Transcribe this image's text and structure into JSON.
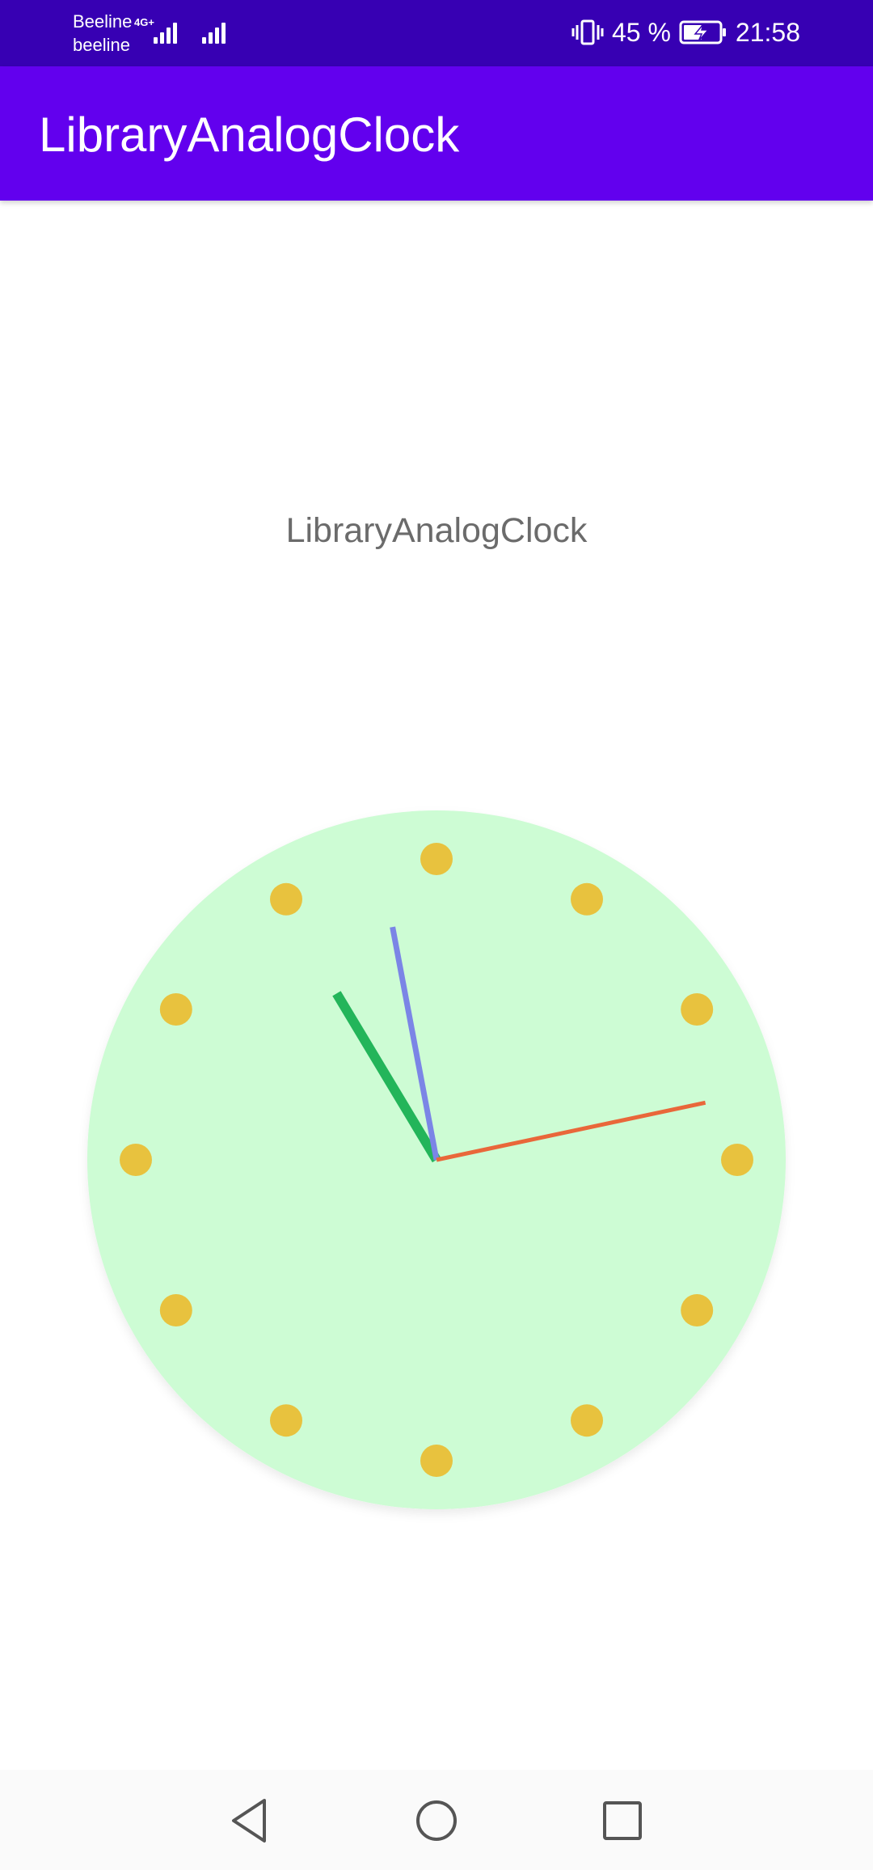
{
  "status_bar": {
    "carrier_1": "Beeline",
    "carrier_2": "beeline",
    "network_type": "4G+",
    "battery_percent": "45 %",
    "time": "21:58",
    "colors": {
      "background": "#3700b3"
    }
  },
  "app_bar": {
    "title": "LibraryAnalogClock",
    "colors": {
      "background": "#6200ee"
    }
  },
  "content": {
    "label": "LibraryAnalogClock"
  },
  "clock": {
    "shown_time": {
      "hour": 10,
      "minute": 58,
      "second": 13
    },
    "hour_markers": 12,
    "colors": {
      "face": "#cdfcd4",
      "markers": "#e8c23e",
      "hour_hand": "#23b55a",
      "minute_hand": "#7b85e6",
      "second_hand": "#e9673a"
    }
  },
  "nav_bar": {
    "buttons": [
      "back-icon",
      "home-icon",
      "recents-icon"
    ]
  }
}
